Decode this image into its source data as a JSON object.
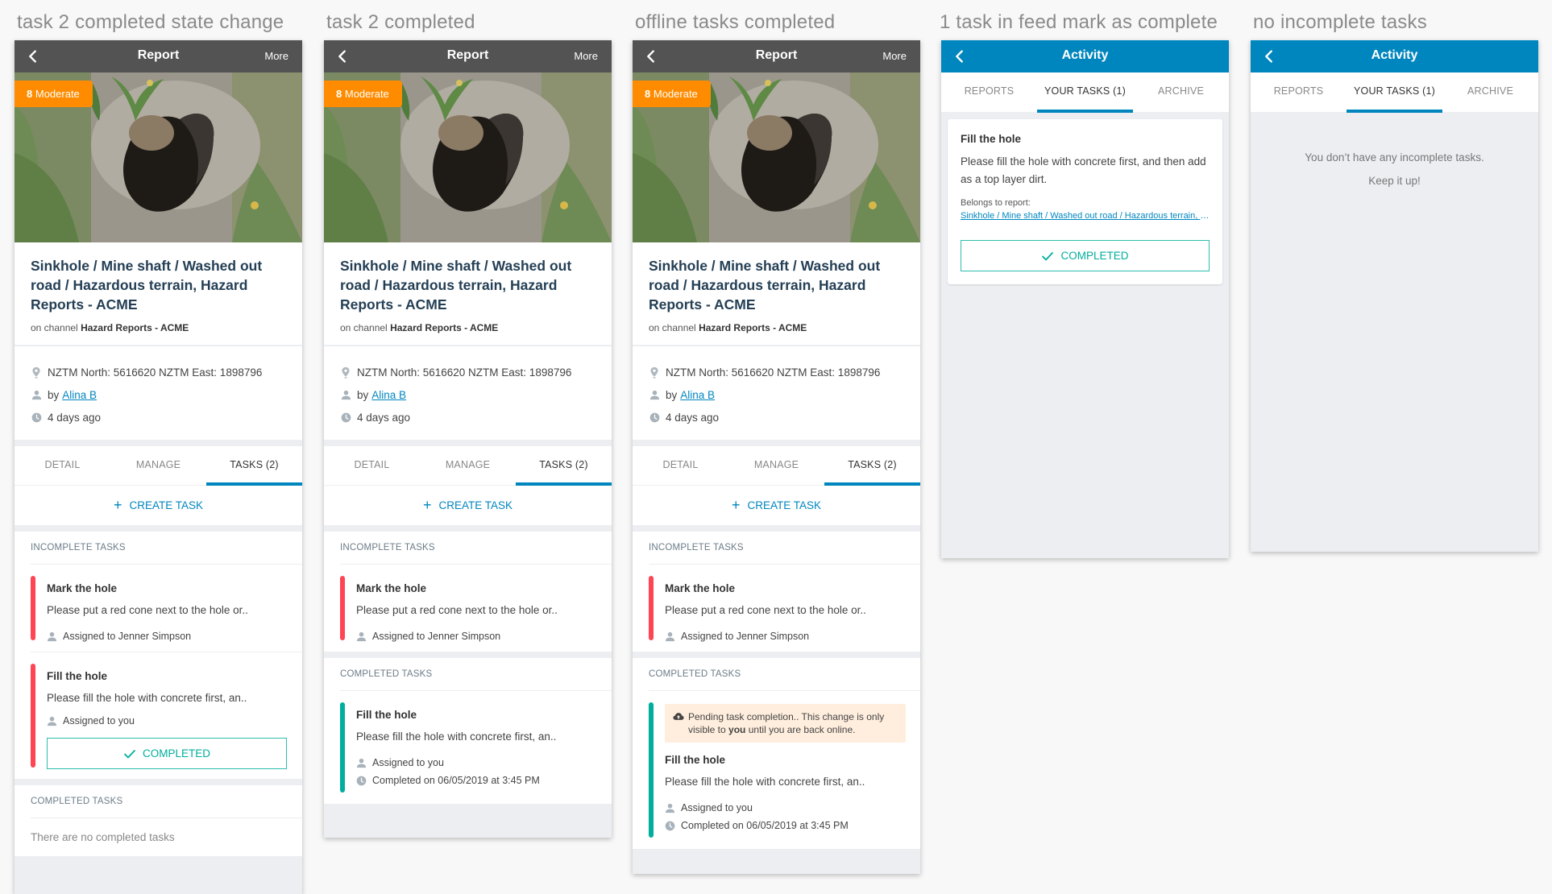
{
  "columns": [
    {
      "caption": "task 2 completed state change",
      "screen": "report",
      "header": {
        "title": "Report",
        "more": "More"
      },
      "badge": {
        "score": "8",
        "level": "Moderate"
      },
      "report": {
        "title": "Sinkhole / Mine shaft / Washed out road / Hazardous terrain, Hazard Reports - ACME",
        "channel_prefix": "on channel",
        "channel": "Hazard Reports - ACME",
        "location": "NZTM North: 5616620 NZTM East: 1898796",
        "by_prefix": "by",
        "author": "Alina B",
        "time": "4 days ago"
      },
      "tabs": [
        "DETAIL",
        "MANAGE",
        "TASKS (2)"
      ],
      "active_tab": 2,
      "create_task": "CREATE TASK",
      "incomplete_header": "INCOMPLETE TASKS",
      "completed_header": "COMPLETED TASKS"
    },
    {
      "caption": "task 2 completed",
      "screen": "report",
      "header": {
        "title": "Report",
        "more": "More"
      },
      "badge": {
        "score": "8",
        "level": "Moderate"
      },
      "report": {
        "title": "Sinkhole / Mine shaft / Washed out road / Hazardous terrain, Hazard Reports - ACME",
        "channel_prefix": "on channel",
        "channel": "Hazard Reports - ACME",
        "location": "NZTM North: 5616620 NZTM East: 1898796",
        "by_prefix": "by",
        "author": "Alina B",
        "time": "4 days ago"
      },
      "tabs": [
        "DETAIL",
        "MANAGE",
        "TASKS (2)"
      ],
      "active_tab": 2,
      "create_task": "CREATE TASK",
      "incomplete_header": "INCOMPLETE TASKS",
      "completed_header": "COMPLETED TASKS"
    },
    {
      "caption": "offline tasks completed",
      "screen": "report",
      "header": {
        "title": "Report",
        "more": "More"
      },
      "badge": {
        "score": "8",
        "level": "Moderate"
      },
      "report": {
        "title": "Sinkhole / Mine shaft / Washed out road / Hazardous terrain, Hazard Reports - ACME",
        "channel_prefix": "on channel",
        "channel": "Hazard Reports - ACME",
        "location": "NZTM North: 5616620 NZTM East: 1898796",
        "by_prefix": "by",
        "author": "Alina B",
        "time": "4 days ago"
      },
      "tabs": [
        "DETAIL",
        "MANAGE",
        "TASKS (2)"
      ],
      "active_tab": 2,
      "create_task": "CREATE TASK",
      "incomplete_header": "INCOMPLETE TASKS",
      "completed_header": "COMPLETED TASKS"
    },
    {
      "caption": "1 task in feed mark as complete",
      "screen": "activity",
      "header": {
        "title": "Activity"
      },
      "tabs": [
        "REPORTS",
        "YOUR TASKS (1)",
        "ARCHIVE"
      ],
      "active_tab": 1
    },
    {
      "caption": "no incomplete tasks",
      "screen": "activity",
      "header": {
        "title": "Activity"
      },
      "tabs": [
        "REPORTS",
        "YOUR TASKS (1)",
        "ARCHIVE"
      ],
      "active_tab": 1
    }
  ],
  "tasks": {
    "mark_hole": {
      "name": "Mark the hole",
      "desc": "Please put a red cone next to the hole or..",
      "assignee": "Assigned to Jenner Simpson"
    },
    "fill_hole": {
      "name": "Fill the hole",
      "desc": "Please fill the hole with concrete first, an..",
      "full_desc": "Please fill the hole with concrete first, and then add as a top layer dirt.",
      "assignee": "Assigned to you",
      "completed_on": "Completed on 06/05/2019 at 3:45 PM"
    }
  },
  "labels": {
    "completed_button": "COMPLETED",
    "no_completed": "There are no completed tasks",
    "pending_notice_a": "Pending task completion.. This change is only visible to",
    "pending_notice_bold": "you",
    "pending_notice_b": "until you are back online.",
    "belongs_to": "Belongs to report:",
    "belongs_link": "Sinkhole / Mine shaft / Washed out road / Hazardous terrain, Hazard Reports - ACME",
    "empty_line1": "You don’t have any incomplete tasks.",
    "empty_line2": "Keep it up!"
  },
  "colors": {
    "report_header": "#535353",
    "activity_header": "#0086bf",
    "accent": "#0086bf",
    "badge": "#ff8c00",
    "incomplete_bar": "#ff4553",
    "completed_bar": "#00ae9e",
    "pending_bg": "#ffeedd"
  }
}
